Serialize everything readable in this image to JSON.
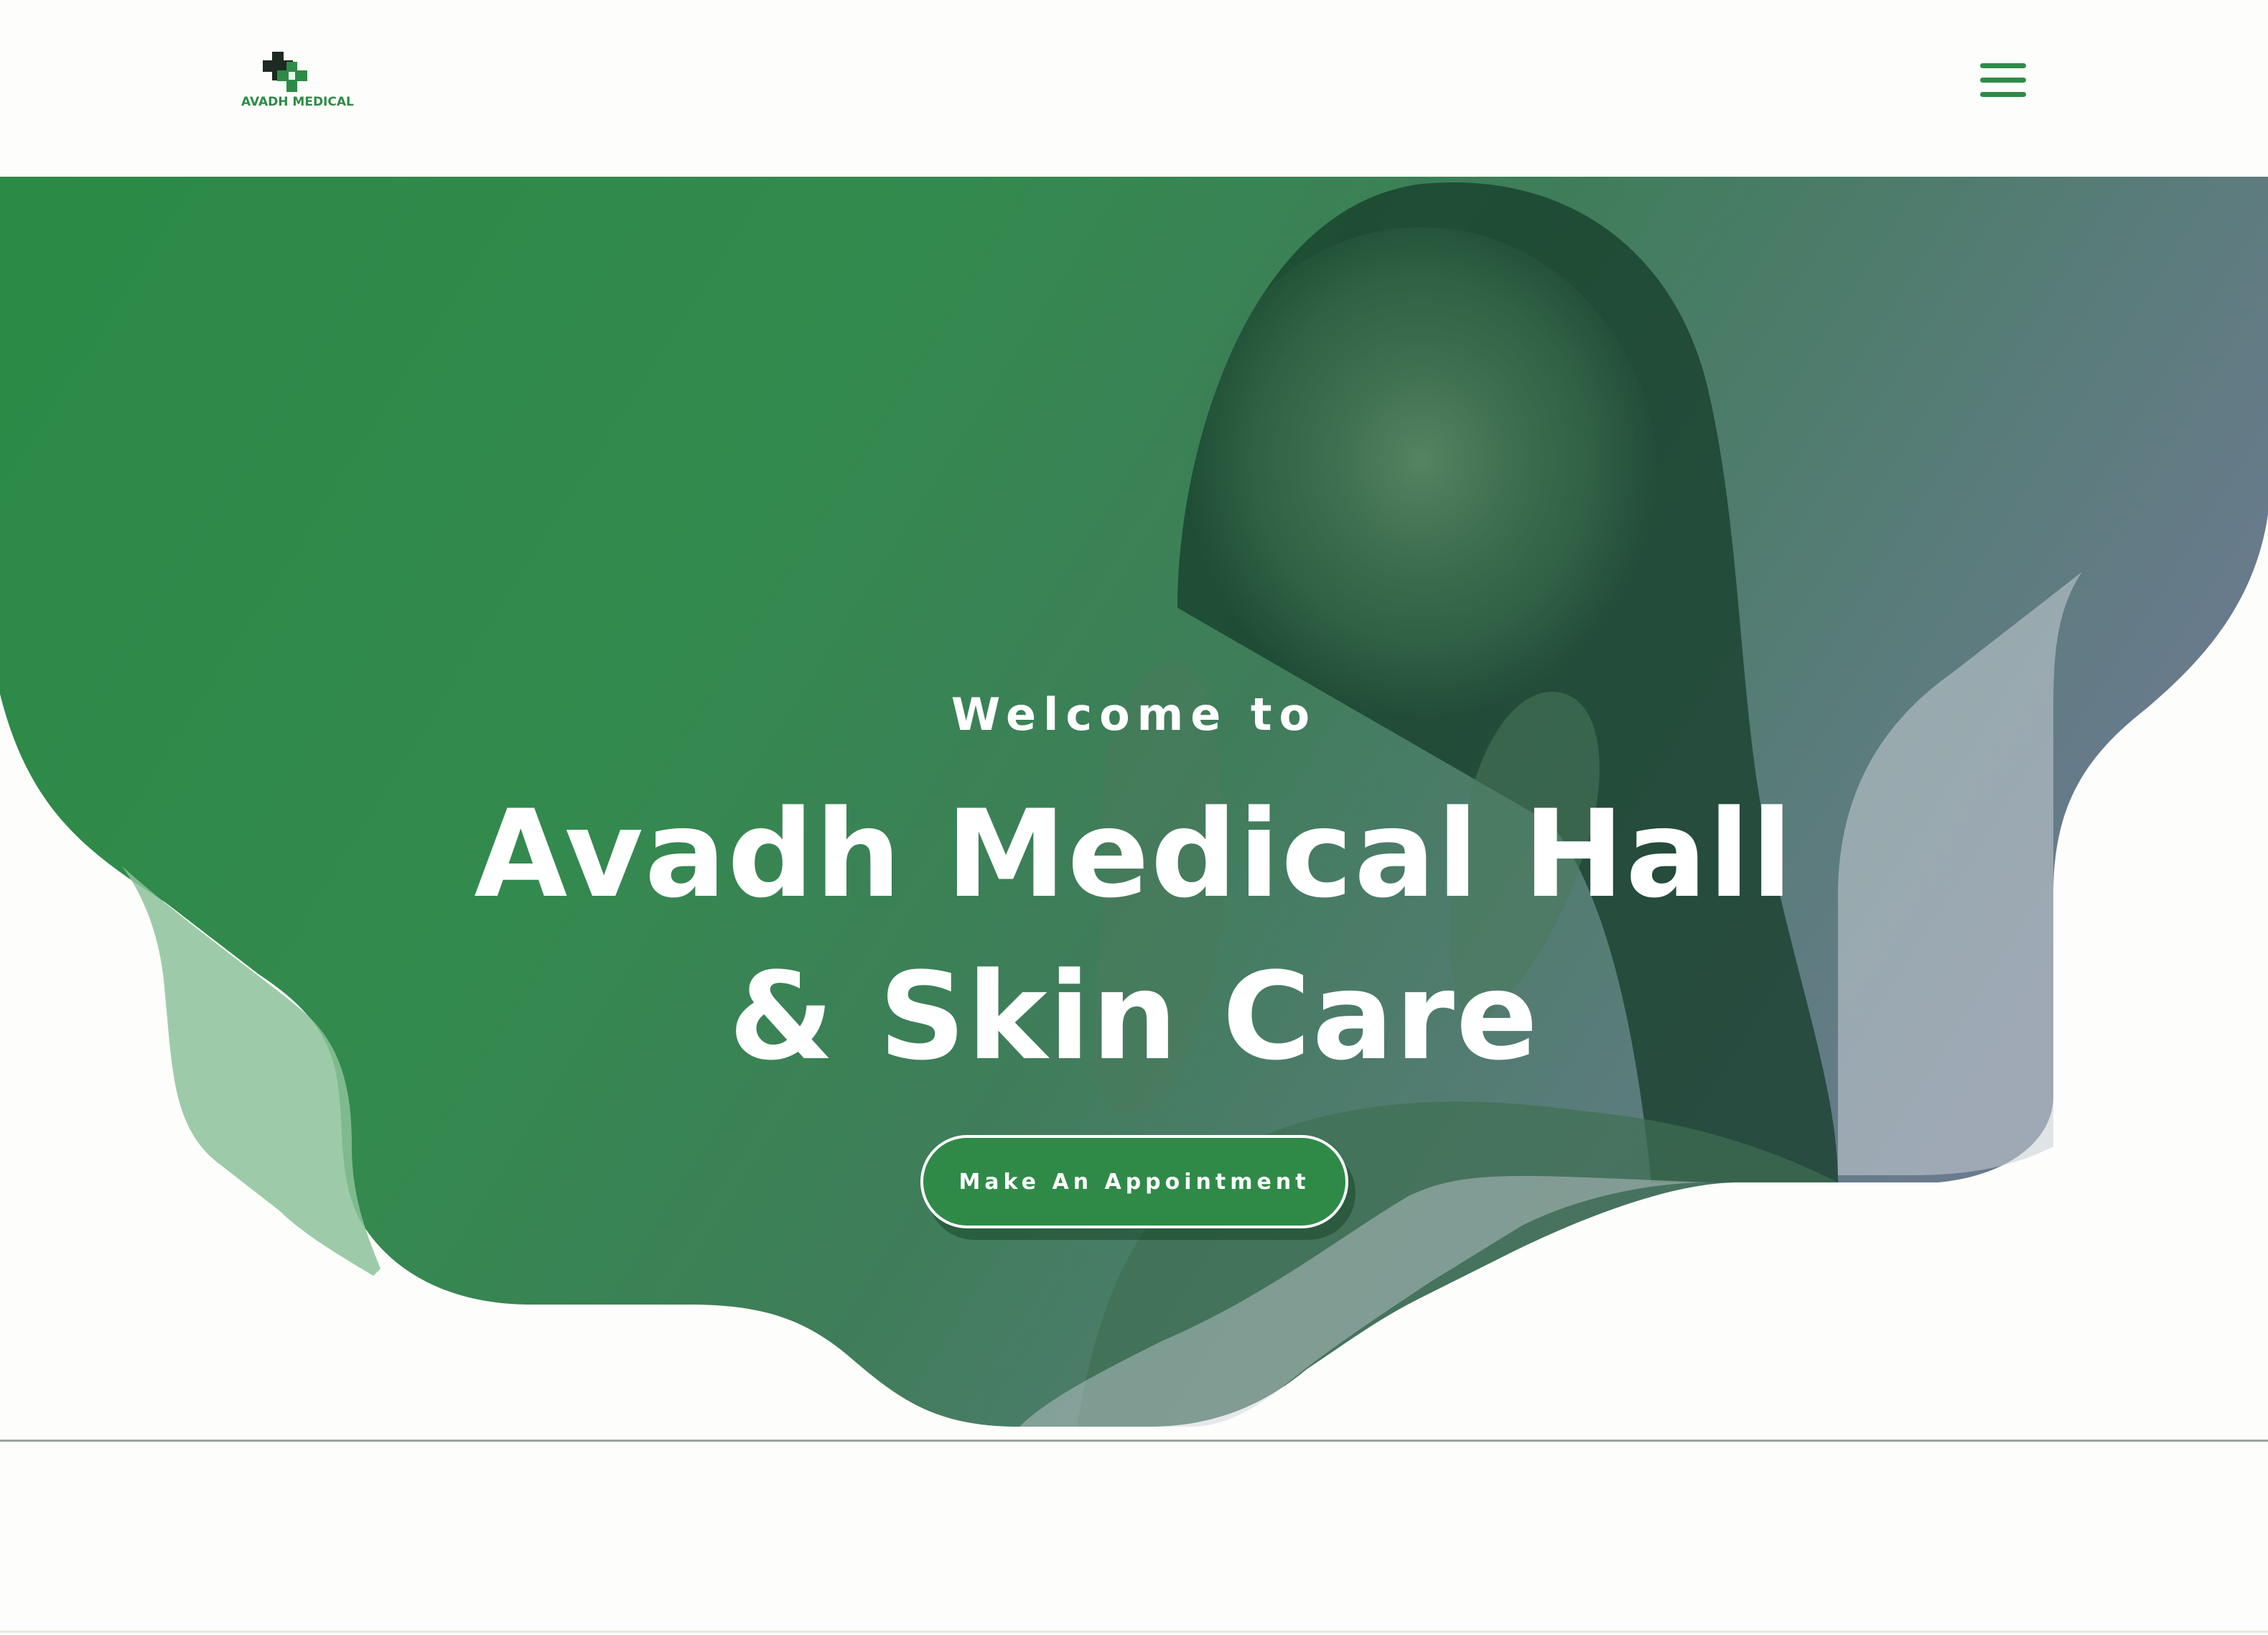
{
  "header": {
    "logo_text": "AVADH MEDICAL",
    "logo_icon": "medical-cross-icon",
    "menu_icon": "hamburger-menu-icon"
  },
  "hero": {
    "welcome": "Welcome to",
    "title_line1": "Avadh Medical Hall",
    "title_line2": "& Skin Care",
    "cta_label": "Make An Appointment",
    "image": "smiling-woman-portrait"
  },
  "colors": {
    "brand_green": "#2e8b47",
    "hero_overlay_start": "#2a8a45",
    "hero_overlay_end": "#6a7d8f",
    "background": "#fdfdfb"
  }
}
